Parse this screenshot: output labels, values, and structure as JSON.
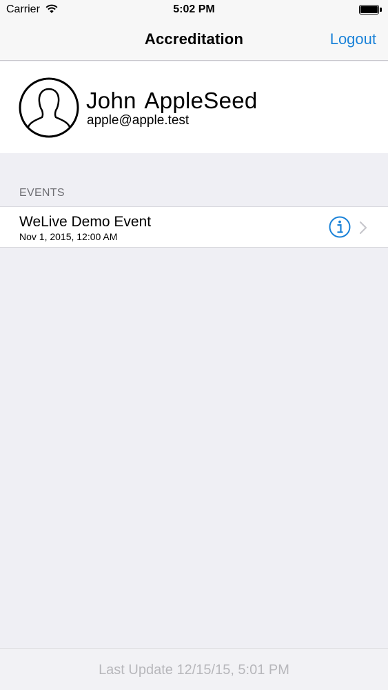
{
  "status_bar": {
    "carrier": "Carrier",
    "time": "5:02 PM",
    "battery_level": 1.0
  },
  "nav_bar": {
    "title": "Accreditation",
    "logout_label": "Logout"
  },
  "profile": {
    "name": "John  AppleSeed",
    "email": "apple@apple.test",
    "avatar_icon": "person-silhouette-icon"
  },
  "events": {
    "section_header": "EVENTS",
    "items": [
      {
        "title": "WeLive Demo Event",
        "date": "Nov 1, 2015, 12:00 AM",
        "info_icon": "info-icon",
        "disclosure_icon": "chevron-right-icon"
      }
    ]
  },
  "footer": {
    "last_update": "Last Update 12/15/15, 5:01 PM"
  },
  "colors": {
    "accent": "#1a82d8",
    "background": "#efeff4",
    "secondary_text": "#6d6d72",
    "footer_text": "#b7b7bb"
  }
}
